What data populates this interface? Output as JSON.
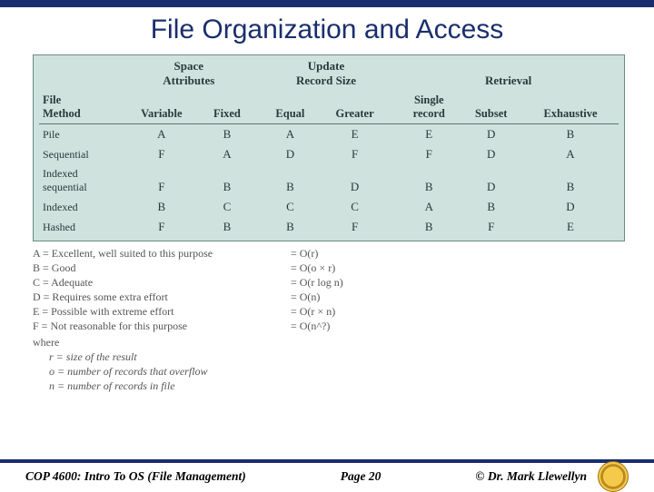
{
  "title": "File Organization and Access",
  "table": {
    "group_headers": {
      "space": "Space\nAttributes",
      "update": "Update\nRecord Size",
      "retrieval": "Retrieval"
    },
    "file_method_label": "File\nMethod",
    "sub_headers": {
      "variable": "Variable",
      "fixed": "Fixed",
      "equal": "Equal",
      "greater": "Greater",
      "single": "Single\nrecord",
      "subset": "Subset",
      "exhaustive": "Exhaustive"
    },
    "rows": [
      {
        "label": "Pile",
        "cells": [
          "A",
          "B",
          "A",
          "E",
          "E",
          "D",
          "B"
        ]
      },
      {
        "label": "Sequential",
        "cells": [
          "F",
          "A",
          "D",
          "F",
          "F",
          "D",
          "A"
        ]
      },
      {
        "label": "Indexed\nsequential",
        "cells": [
          "F",
          "B",
          "B",
          "D",
          "B",
          "D",
          "B"
        ]
      },
      {
        "label": "Indexed",
        "cells": [
          "B",
          "C",
          "C",
          "C",
          "A",
          "B",
          "D"
        ]
      },
      {
        "label": "Hashed",
        "cells": [
          "F",
          "B",
          "B",
          "F",
          "B",
          "F",
          "E"
        ]
      }
    ]
  },
  "legend": {
    "grades": [
      "A = Excellent, well suited to this purpose",
      "B = Good",
      "C = Adequate",
      "D = Requires some extra effort",
      "E = Possible with extreme effort",
      "F = Not reasonable for this purpose"
    ],
    "where_label": "where",
    "defs": [
      "r = size of the result",
      "o = number of records that overflow",
      "n = number of records in file"
    ],
    "complexities": [
      "= O(r)",
      "= O(o × r)",
      "= O(r log n)",
      "= O(n)",
      "= O(r × n)",
      "= O(n^?)"
    ]
  },
  "footer": {
    "left": "COP 4600: Intro To OS  (File Management)",
    "center": "Page 20",
    "right": "© Dr. Mark Llewellyn"
  },
  "chart_data": {
    "type": "table",
    "title": "File Organization and Access",
    "row_labels": [
      "Pile",
      "Sequential",
      "Indexed sequential",
      "Indexed",
      "Hashed"
    ],
    "column_groups": {
      "Space Attributes": [
        "Variable",
        "Fixed"
      ],
      "Update Record Size": [
        "Equal",
        "Greater"
      ],
      "Retrieval": [
        "Single record",
        "Subset",
        "Exhaustive"
      ]
    },
    "columns": [
      "Variable",
      "Fixed",
      "Equal",
      "Greater",
      "Single record",
      "Subset",
      "Exhaustive"
    ],
    "data": [
      [
        "A",
        "B",
        "A",
        "E",
        "E",
        "D",
        "B"
      ],
      [
        "F",
        "A",
        "D",
        "F",
        "F",
        "D",
        "A"
      ],
      [
        "F",
        "B",
        "B",
        "D",
        "B",
        "D",
        "B"
      ],
      [
        "B",
        "C",
        "C",
        "C",
        "A",
        "B",
        "D"
      ],
      [
        "F",
        "B",
        "B",
        "F",
        "B",
        "F",
        "E"
      ]
    ],
    "grade_key": {
      "A": "Excellent, well suited to this purpose",
      "B": "Good",
      "C": "Adequate",
      "D": "Requires some extra effort",
      "E": "Possible with extreme effort",
      "F": "Not reasonable for this purpose"
    }
  }
}
